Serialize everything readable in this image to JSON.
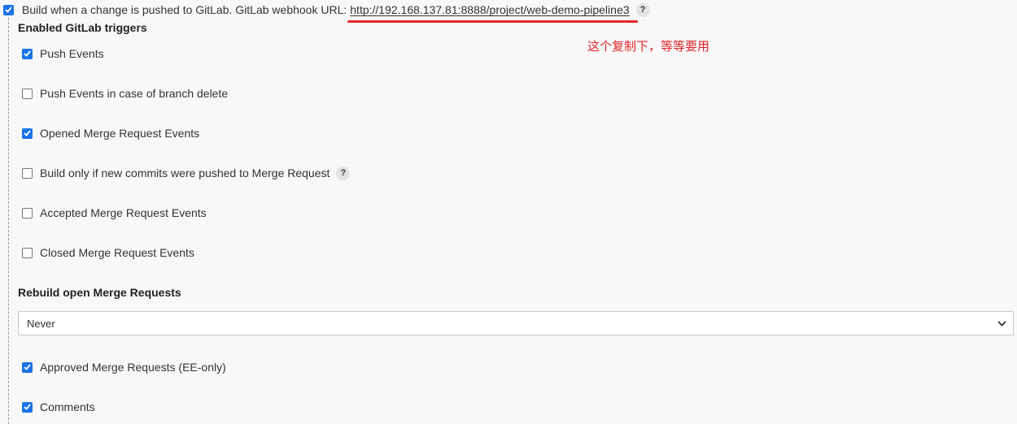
{
  "trigger": {
    "checked": true,
    "label": "Build when a change is pushed to GitLab. GitLab webhook URL:",
    "url": "http://192.168.137.81:8888/project/web-demo-pipeline3",
    "help": "?"
  },
  "annotation": "这个复制下，等等要用",
  "enabled_triggers": {
    "heading": "Enabled GitLab triggers",
    "items": [
      {
        "label": "Push Events",
        "checked": true
      },
      {
        "label": "Push Events in case of branch delete",
        "checked": false
      },
      {
        "label": "Opened Merge Request Events",
        "checked": true
      },
      {
        "label": "Build only if new commits were pushed to Merge Request",
        "checked": false,
        "help": "?"
      },
      {
        "label": "Accepted Merge Request Events",
        "checked": false
      },
      {
        "label": "Closed Merge Request Events",
        "checked": false
      }
    ]
  },
  "rebuild": {
    "heading": "Rebuild open Merge Requests",
    "selected": "Never"
  },
  "extra_triggers": [
    {
      "label": "Approved Merge Requests (EE-only)",
      "checked": true
    },
    {
      "label": "Comments",
      "checked": true
    }
  ],
  "colors": {
    "checkbox_checked": "#1a73e8",
    "annotation_red": "#e0262a"
  }
}
